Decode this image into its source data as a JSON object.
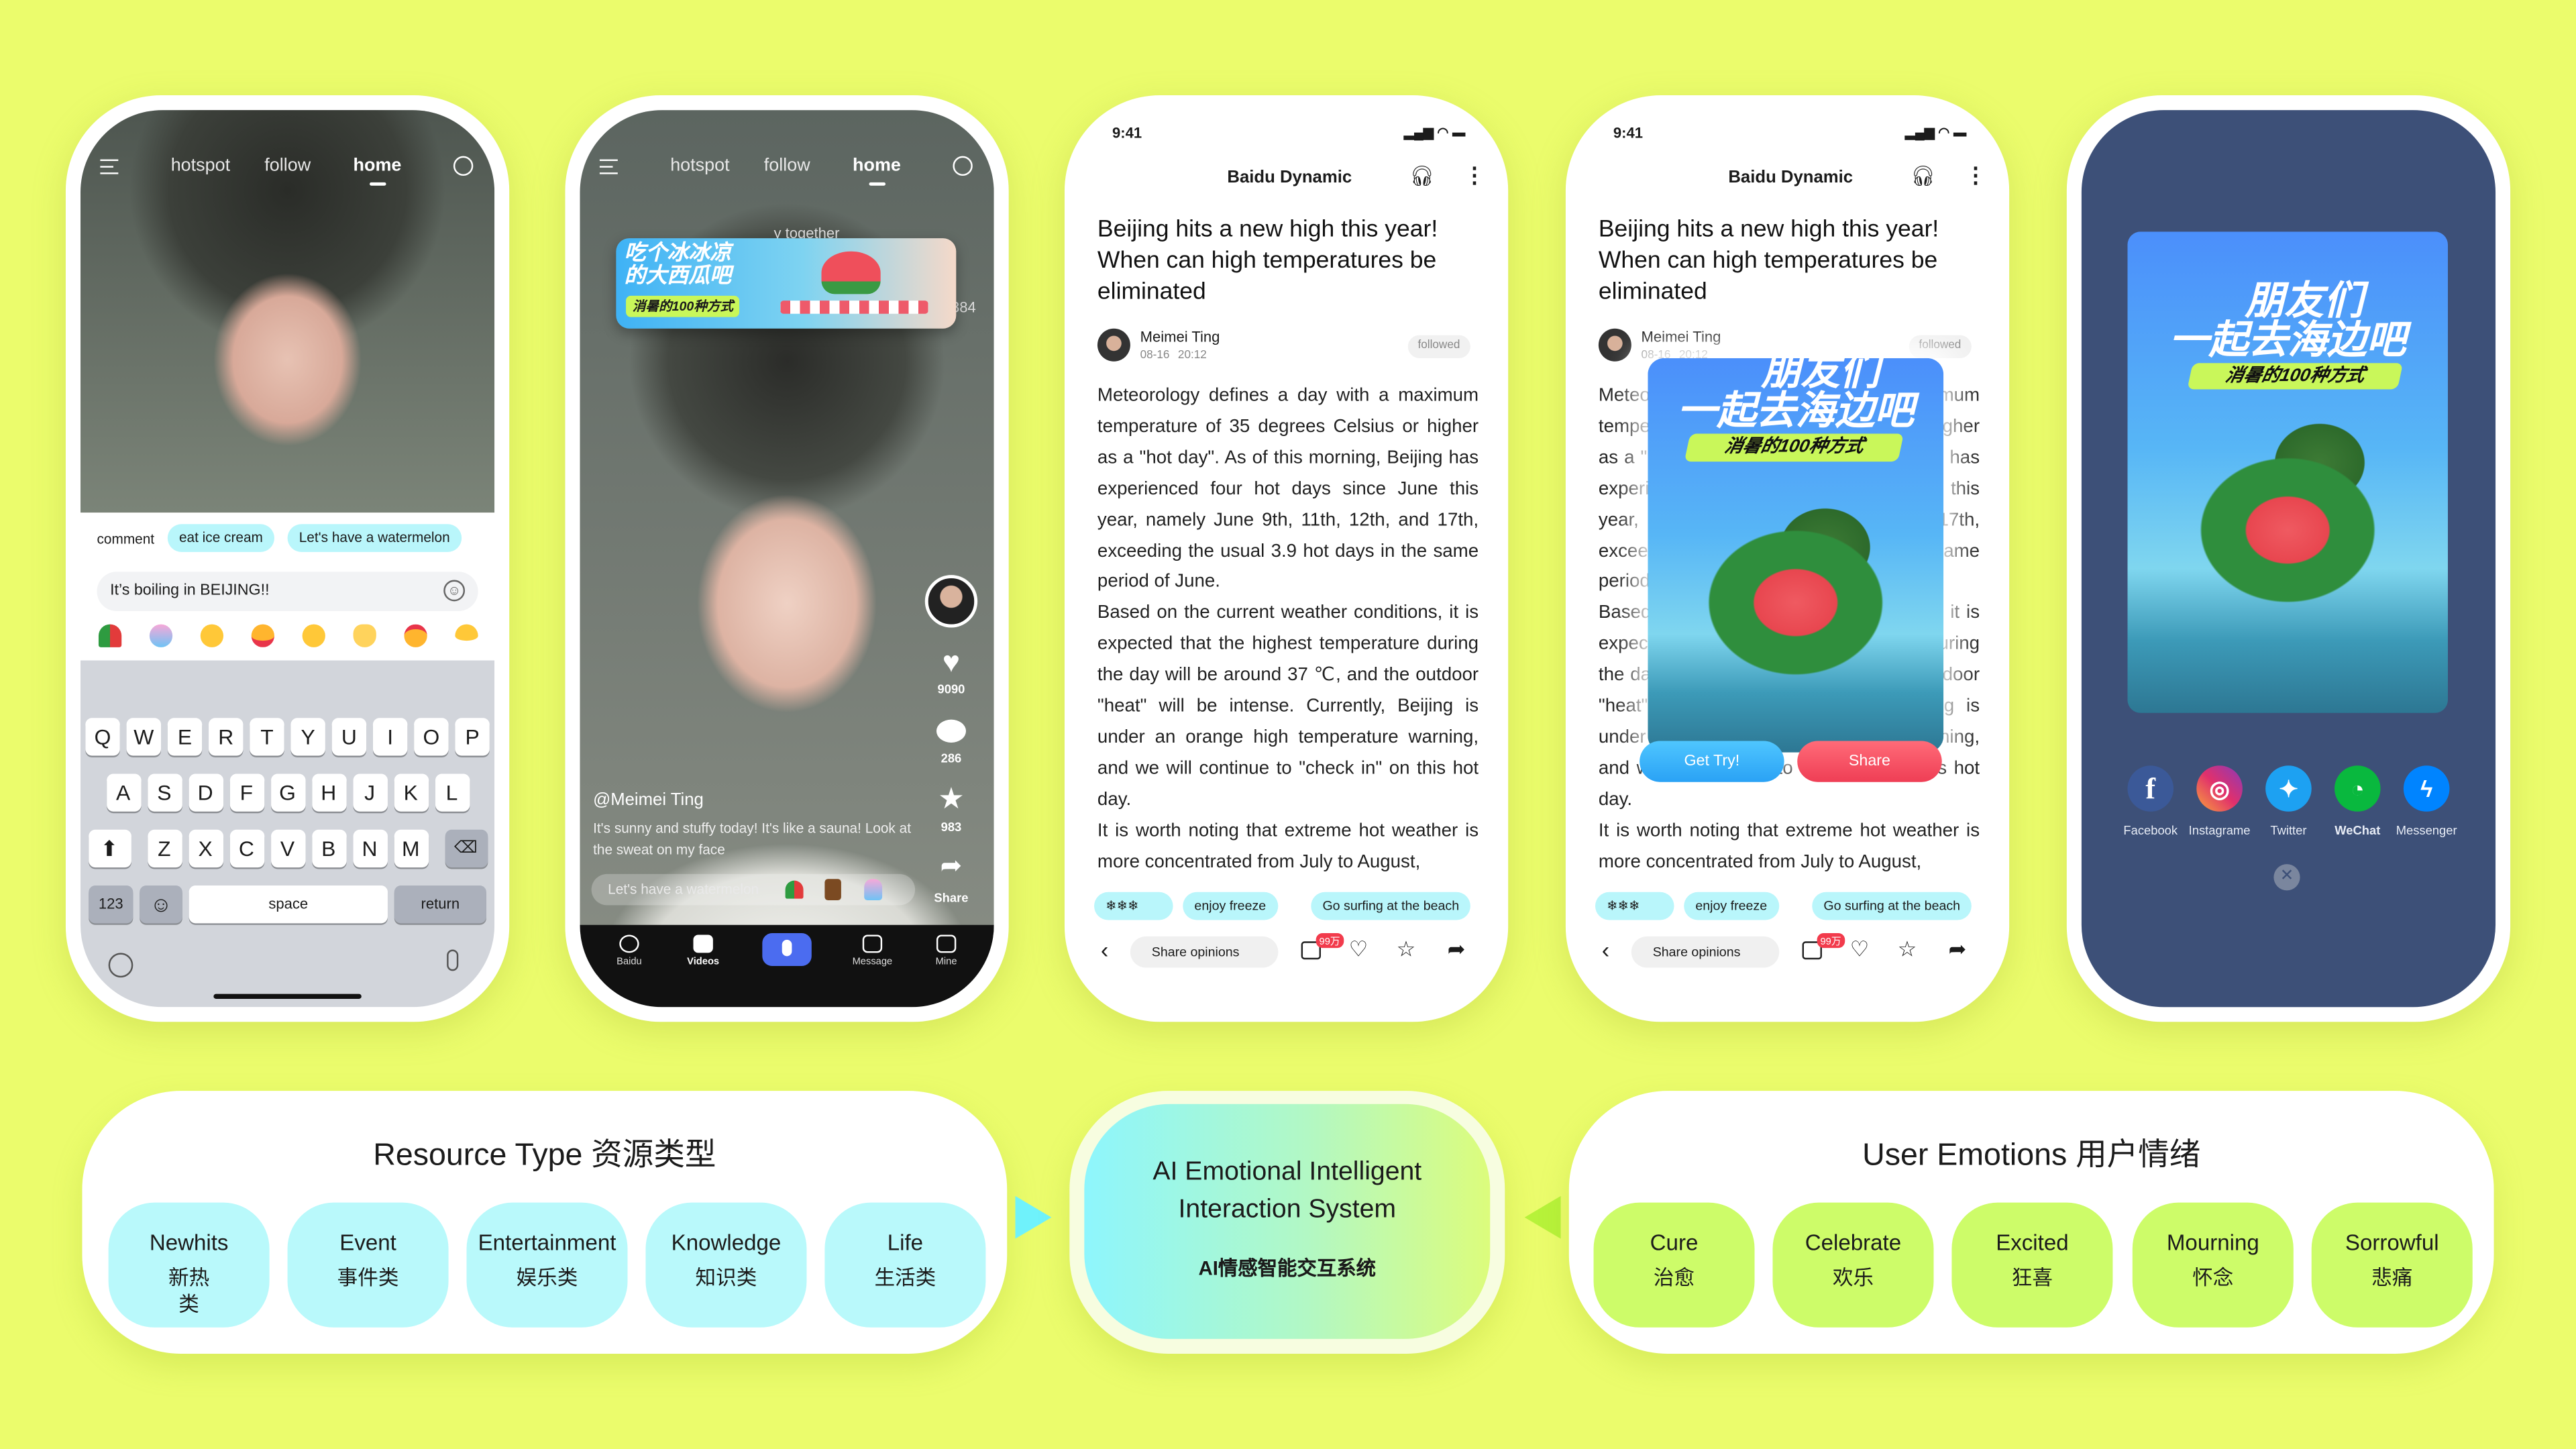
{
  "colors": {
    "background": "#ebfc6c",
    "cyan_chip": "#b9f6fb",
    "green_chip": "#cdfc69",
    "accent_blue": "#4b6cf0",
    "share_red": "#f5505f"
  },
  "feed_nav": {
    "items": [
      "hotspot",
      "follow",
      "home"
    ],
    "active": "home"
  },
  "phone1": {
    "comment_label": "comment",
    "suggestions": [
      "eat ice cream",
      "Let's have a watermelon"
    ],
    "input_value": "It’s boiling in BEIJING!!",
    "emojis": [
      "watermelon",
      "popsicle",
      "yummy-face",
      "laughing-face",
      "surprised-face",
      "ok-hand",
      "angry-face",
      "grinning-face"
    ],
    "keyboard": {
      "row1": [
        "Q",
        "W",
        "E",
        "R",
        "T",
        "Y",
        "U",
        "I",
        "O",
        "P"
      ],
      "row2": [
        "A",
        "S",
        "D",
        "F",
        "G",
        "H",
        "J",
        "K",
        "L"
      ],
      "row3": [
        "Z",
        "X",
        "C",
        "V",
        "B",
        "N",
        "M"
      ],
      "numbers": "123",
      "space": "space",
      "return": "return"
    }
  },
  "phone2": {
    "banner": {
      "line1": "吃个冰冰凉",
      "line2": "的大西瓜吧",
      "tag": "消暑的100种方式",
      "behind_text": "y together",
      "count": "384"
    },
    "likes": "9090",
    "comments": "286",
    "favorites": "983",
    "share": "Share",
    "author": "@Meimei Ting",
    "caption": "It's sunny and stuffy today! It's like a sauna! Look at the sweat on my face",
    "input_placeholder": "Let's have a watermelon",
    "tabs": [
      "Baidu",
      "Videos",
      "Message",
      "Mine"
    ]
  },
  "article": {
    "time": "9:41",
    "header": "Baidu Dynamic",
    "title": "Beijing hits a new high this year! When can high temperatures be eliminated",
    "author": "Meimei Ting",
    "date": "08-16",
    "clock": "20:12",
    "follow_status": "followed",
    "paragraphs": [
      "Meteorology defines a day with a maximum temperature of 35 degrees Celsius or higher as a \"hot day\". As of this morning, Beijing has experienced four hot days since June this year, namely June 9th, 11th, 12th, and 17th, exceeding the usual 3.9 hot days in the same period of June.",
      "Based on the current weather conditions, it is expected that the highest temperature during the day will be around 37 ℃, and the outdoor \"heat\" will be intense. Currently, Beijing is under an orange high temperature warning, and we will continue to \"check in\" on this hot day.",
      "It is worth noting that extreme hot weather is more concentrated from July to August,"
    ],
    "chips": [
      "enjoy freeze",
      "Go surfing at the beach"
    ],
    "comment_placeholder": "Share opinions",
    "comment_badge": "99万"
  },
  "popup": {
    "line1": "朋友们",
    "line2": "一起去海边吧",
    "tag": "消暑的100种方式",
    "try_button": "Get Try!",
    "share_button": "Share"
  },
  "share_sheet": {
    "targets": [
      {
        "label": "Facebook",
        "icon": "facebook-icon",
        "color": "#3b5998"
      },
      {
        "label": "Instagrame",
        "icon": "instagram-icon",
        "color": "#e1306c"
      },
      {
        "label": "Twitter",
        "icon": "twitter-icon",
        "color": "#1da1f2"
      },
      {
        "label": "WeChat",
        "icon": "wechat-icon",
        "color": "#09b83e"
      },
      {
        "label": "Messenger",
        "icon": "messenger-icon",
        "color": "#0084ff"
      }
    ]
  },
  "resource_panel": {
    "title": "Resource Type  资源类型",
    "items": [
      {
        "en": "Newhits",
        "zh": "新热类"
      },
      {
        "en": "Event",
        "zh": "事件类"
      },
      {
        "en": "Entertainment",
        "zh": "娱乐类"
      },
      {
        "en": "Knowledge",
        "zh": "知识类"
      },
      {
        "en": "Life",
        "zh": "生活类"
      }
    ]
  },
  "ai_system": {
    "title": "AI Emotional Intelligent Interaction System",
    "subtitle": "AI情感智能交互系统"
  },
  "emotion_panel": {
    "title": "User Emotions  用户情绪",
    "items": [
      {
        "en": "Cure",
        "zh": "治愈"
      },
      {
        "en": "Celebrate",
        "zh": "欢乐"
      },
      {
        "en": "Excited",
        "zh": "狂喜"
      },
      {
        "en": "Mourning",
        "zh": "怀念"
      },
      {
        "en": "Sorrowful",
        "zh": "悲痛"
      }
    ]
  }
}
